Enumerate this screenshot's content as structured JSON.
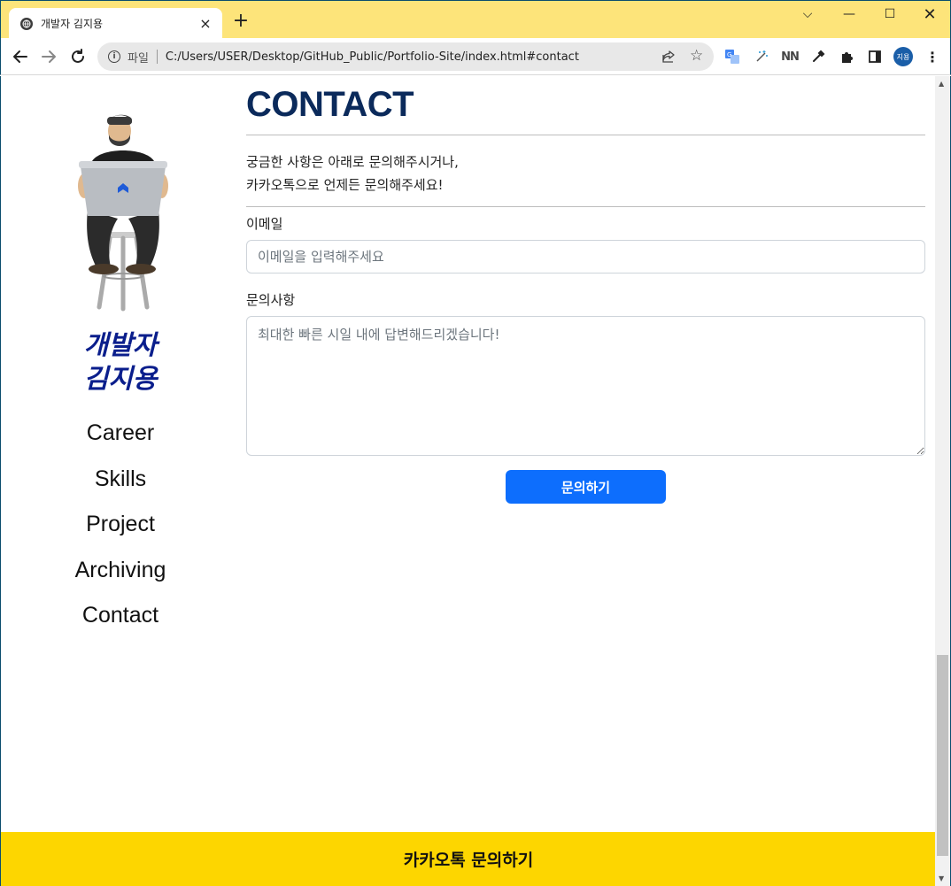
{
  "browser": {
    "tab_title": "개발자 김지용",
    "tab_close": "×",
    "new_tab": "+",
    "window_controls": {
      "dropdown": "⌵",
      "minimize": "—",
      "maximize": "☐",
      "close": "✕"
    },
    "scheme_label": "파일",
    "url": "C:/Users/USER/Desktop/GitHub_Public/Portfolio-Site/index.html#contact",
    "profile_initials": "지용",
    "icons": [
      "back-arrow-icon",
      "forward-arrow-icon",
      "reload-icon",
      "info-icon",
      "share-icon",
      "star-icon",
      "translate-icon",
      "sparkle-icon",
      "nn-extension-icon",
      "eyedropper-icon",
      "puzzle-icon",
      "side-panel-icon",
      "menu-dots-icon"
    ],
    "extension_nn": "NN",
    "menu": "⋮",
    "star": "☆"
  },
  "sidebar": {
    "brand_line1": "개발자",
    "brand_line2": "김지용",
    "nav": [
      "Career",
      "Skills",
      "Project",
      "Archiving",
      "Contact"
    ]
  },
  "contact": {
    "title": "CONTACT",
    "intro_line1": "궁금한 사항은 아래로 문의해주시거나,",
    "intro_line2": "카카오톡으로 언제든 문의해주세요!",
    "email_label": "이메일",
    "email_placeholder": "이메일을 입력해주세요",
    "inquiry_label": "문의사항",
    "inquiry_placeholder": "최대한 빠른 시일 내에 답변해드리겠습니다!",
    "submit_label": "문의하기"
  },
  "footer": {
    "kakao_label": "카카오톡 문의하기"
  },
  "colors": {
    "titlebar": "#fde47a",
    "title_color": "#0b2a5b",
    "brand_color": "#0a1e8c",
    "button_blue": "#0d6efd",
    "kakao_yellow": "#fdd600"
  }
}
